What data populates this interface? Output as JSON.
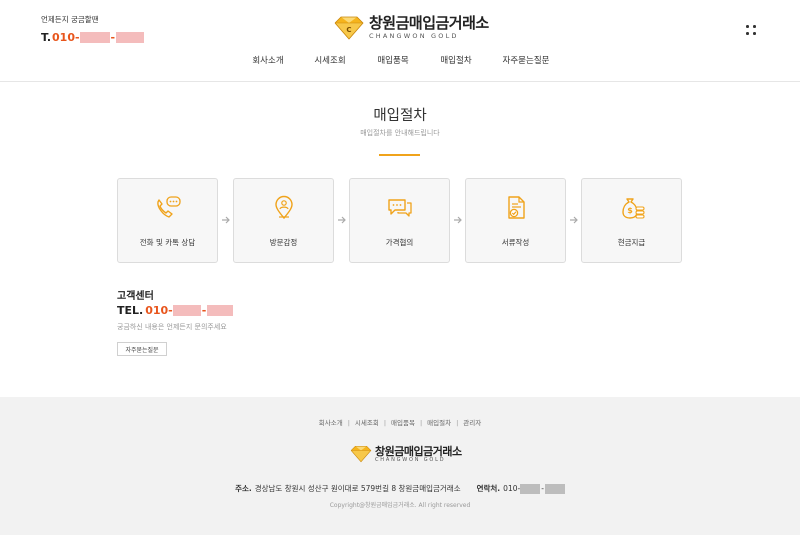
{
  "header": {
    "contact_label": "언제든지 궁금할땐",
    "tel_prefix": "T.",
    "tel_number": "010-",
    "brand_name": "창원금매입금거래소",
    "brand_en": "CHANGWON GOLD"
  },
  "nav": [
    "회사소개",
    "시세조회",
    "매입품목",
    "매입절차",
    "자주묻는질문"
  ],
  "page": {
    "title": "매입절차",
    "subtitle": "매입절차를 안내해드립니다"
  },
  "steps": [
    {
      "label": "전화 및 카톡 상담",
      "icon": "phone-chat-icon"
    },
    {
      "label": "방문감정",
      "icon": "location-person-icon"
    },
    {
      "label": "가격협의",
      "icon": "chat-bubbles-icon"
    },
    {
      "label": "서류작성",
      "icon": "document-check-icon"
    },
    {
      "label": "현금지급",
      "icon": "money-bag-coins-icon"
    }
  ],
  "customer_center": {
    "title": "고객센터",
    "tel_prefix": "TEL.",
    "tel_number": "010-",
    "desc": "궁금하신 내용은 언제든지 문의주세요",
    "faq_button": "자주묻는질문"
  },
  "footer": {
    "nav": [
      "회사소개",
      "시세조회",
      "매입품목",
      "매입절차",
      "관리자"
    ],
    "brand_name": "창원금매입금거래소",
    "brand_en": "CHANGWON GOLD",
    "address_label": "주소.",
    "address": "경상남도 창원시 성산구 원이대로 579번길 8 창원금매입금거래소",
    "contact_label": "연락처.",
    "contact_number": "010-",
    "copyright": "Copyright@창원금매입금거래소. All right reserved"
  },
  "colors": {
    "accent": "#f0a31b",
    "tel": "#e8551c",
    "footer_bg": "#f2f2f2"
  }
}
